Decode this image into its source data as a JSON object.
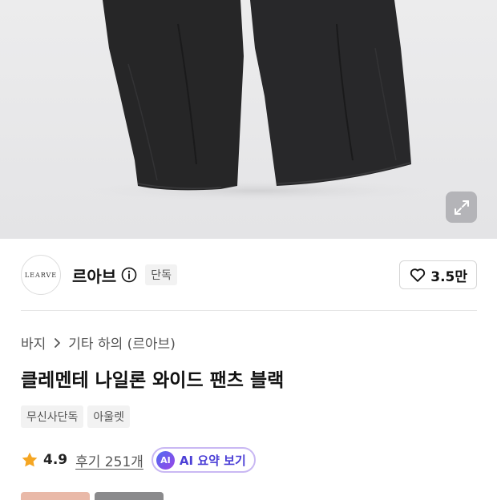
{
  "brand": {
    "logo_text": "LEARVE",
    "name": "르아브",
    "exclusive_badge": "단독",
    "like_count": "3.5만"
  },
  "breadcrumb": [
    "바지",
    "기타 하의 (르아브)"
  ],
  "product": {
    "title": "클레멘테 나일론 와이드 팬츠 블랙",
    "tags": [
      "무신사단독",
      "아울렛"
    ]
  },
  "rating": {
    "value": "4.9",
    "reviews": "후기 251개",
    "ai_badge": "AI",
    "ai_summary_label": "AI 요약 보기"
  },
  "colors": {
    "ai_accent": "#4b3fd6",
    "star": "#f5a623",
    "pants": "#262627"
  },
  "icons": [
    "expand-icon",
    "info-icon",
    "heart-icon",
    "chevron-right-icon",
    "star-icon"
  ]
}
